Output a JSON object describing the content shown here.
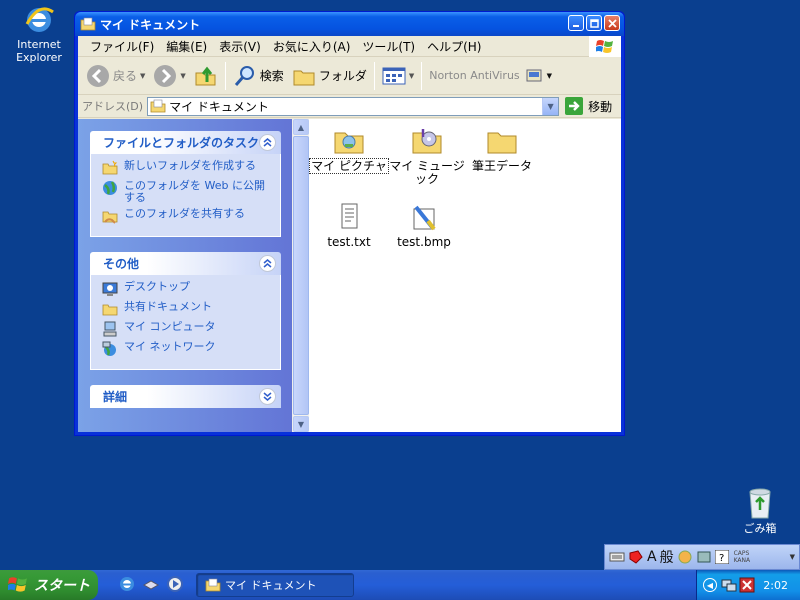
{
  "desktop": {
    "ie_label_line1": "Internet",
    "ie_label_line2": "Explorer",
    "recycle_label": "ごみ箱"
  },
  "window": {
    "title": "マイ ドキュメント",
    "menu": [
      "ファイル(F)",
      "編集(E)",
      "表示(V)",
      "お気に入り(A)",
      "ツール(T)",
      "ヘルプ(H)"
    ],
    "toolbar": {
      "back": "戻る",
      "search": "検索",
      "folders": "フォルダ",
      "norton": "Norton AntiVirus"
    },
    "address": {
      "label": "アドレス(D)",
      "value": "マイ ドキュメント",
      "go": "移動"
    }
  },
  "taskpane": {
    "tasks": {
      "header": "ファイルとフォルダのタスク",
      "items": [
        "新しいフォルダを作成する",
        "このフォルダを Web に公開する",
        "このフォルダを共有する"
      ]
    },
    "other": {
      "header": "その他",
      "items": [
        "デスクトップ",
        "共有ドキュメント",
        "マイ コンピュータ",
        "マイ ネットワーク"
      ]
    },
    "details": {
      "header": "詳細"
    }
  },
  "files": [
    {
      "name": "マイ ピクチャ",
      "icon": "pictures-folder-icon"
    },
    {
      "name": "マイ ミュージック",
      "icon": "music-folder-icon"
    },
    {
      "name": "筆王データ",
      "icon": "folder-icon"
    },
    {
      "name": "test.txt",
      "icon": "text-file-icon"
    },
    {
      "name": "test.bmp",
      "icon": "bitmap-file-icon"
    }
  ],
  "taskbar": {
    "start": "スタート",
    "task": "マイ ドキュメント",
    "clock": "2:02"
  },
  "langbar": {
    "mode_a": "A",
    "mode_kanji": "般",
    "caps": "CAPS",
    "kana": "KANA"
  }
}
